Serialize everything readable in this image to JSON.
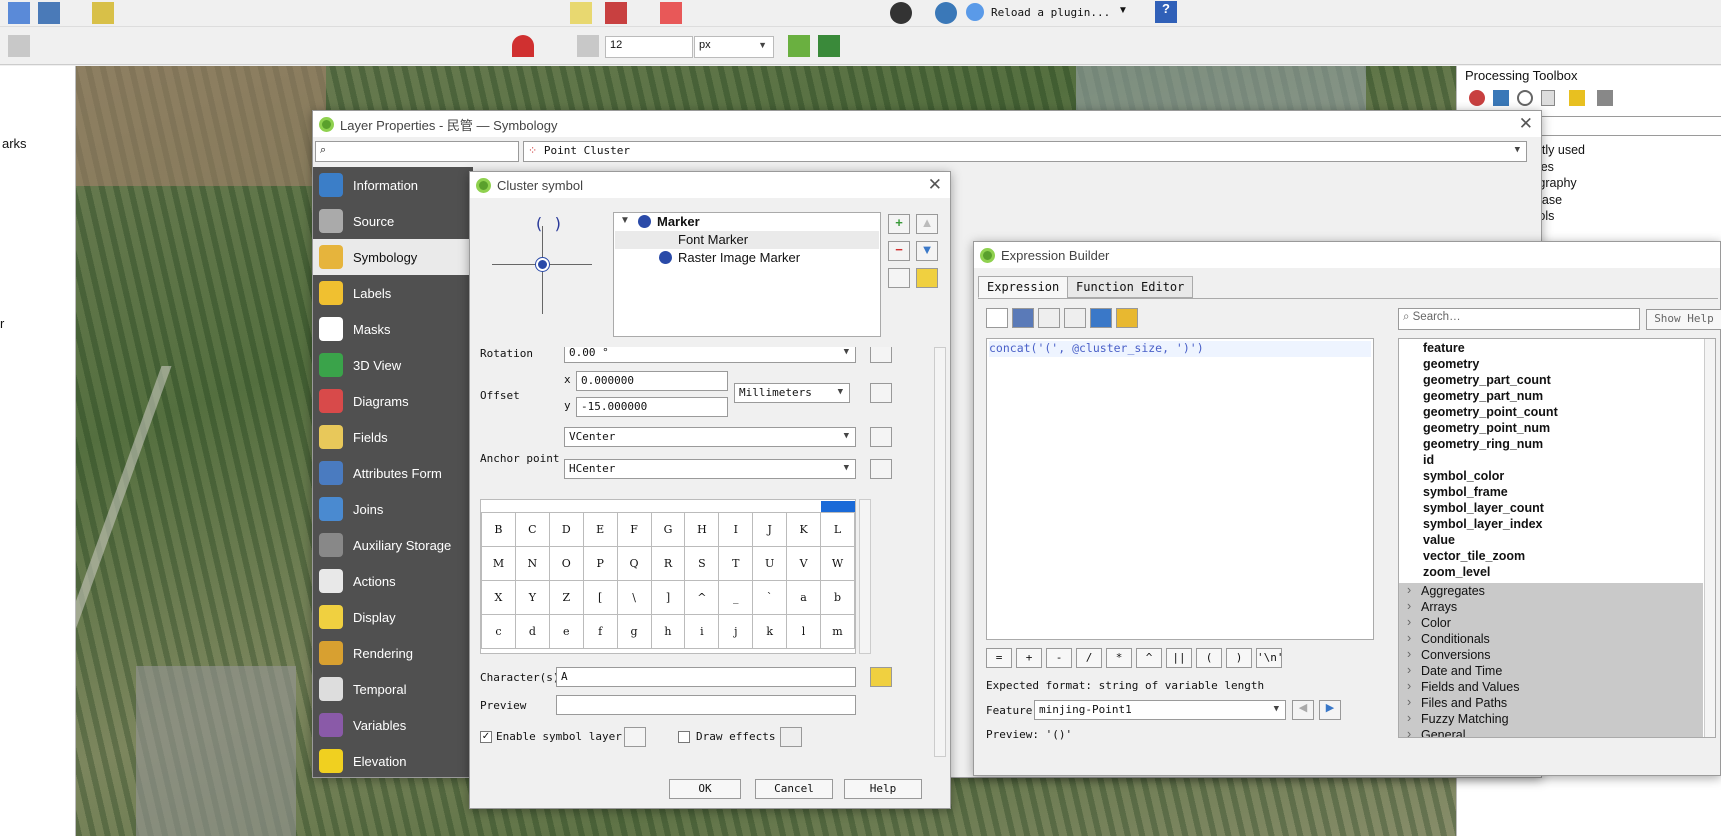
{
  "toolbar": {
    "reload_label": "Reload a plugin...",
    "size_value": "12",
    "size_unit": "px"
  },
  "processing": {
    "title": "Processing Toolbox",
    "items": [
      "ently used",
      "Tiles",
      "tography",
      "abase",
      "tools"
    ],
    "search_placeholder": "..."
  },
  "leftdock": {
    "items": [
      "arks",
      "r"
    ]
  },
  "layer_props": {
    "title": "Layer Properties - 民管 — Symbology",
    "renderer": "Point Cluster",
    "nav": [
      {
        "label": "Information",
        "icon": "info-icon",
        "color": "#3b7ec8"
      },
      {
        "label": "Source",
        "icon": "source-icon",
        "color": "#aaaaaa"
      },
      {
        "label": "Symbology",
        "icon": "brush-icon",
        "color": "#e6b43c"
      },
      {
        "label": "Labels",
        "icon": "labels-icon",
        "color": "#f0c030"
      },
      {
        "label": "Masks",
        "icon": "masks-icon",
        "color": "#ffffff"
      },
      {
        "label": "3D View",
        "icon": "cube-icon",
        "color": "#3aa34a"
      },
      {
        "label": "Diagrams",
        "icon": "diagrams-icon",
        "color": "#d84a4a"
      },
      {
        "label": "Fields",
        "icon": "fields-icon",
        "color": "#e8c85a"
      },
      {
        "label": "Attributes Form",
        "icon": "form-icon",
        "color": "#4a7bc0"
      },
      {
        "label": "Joins",
        "icon": "joins-icon",
        "color": "#4a8ad0"
      },
      {
        "label": "Auxiliary Storage",
        "icon": "storage-icon",
        "color": "#888888"
      },
      {
        "label": "Actions",
        "icon": "actions-icon",
        "color": "#e8e8e8"
      },
      {
        "label": "Display",
        "icon": "display-icon",
        "color": "#f0d040"
      },
      {
        "label": "Rendering",
        "icon": "rendering-icon",
        "color": "#d8a030"
      },
      {
        "label": "Temporal",
        "icon": "clock-icon",
        "color": "#dddddd"
      },
      {
        "label": "Variables",
        "icon": "variables-icon",
        "color": "#8a5aa8"
      },
      {
        "label": "Elevation",
        "icon": "elevation-icon",
        "color": "#f0d020"
      }
    ]
  },
  "cluster": {
    "title": "Cluster symbol",
    "tree": {
      "root": "Marker",
      "children": [
        "Font Marker",
        "Raster Image Marker"
      ]
    },
    "rotation_label": "Rotation",
    "rotation_value": "0.00 °",
    "offset_label": "Offset",
    "offset_x_label": "x",
    "offset_x": "0.000000",
    "offset_y_label": "y",
    "offset_y": "-15.000000",
    "offset_unit": "Millimeters",
    "anchor_label": "Anchor point",
    "anchor_v": "VCenter",
    "anchor_h": "HCenter",
    "char_rows": [
      [
        "B",
        "C",
        "D",
        "E",
        "F",
        "G",
        "H",
        "I",
        "J",
        "K",
        "L"
      ],
      [
        "M",
        "N",
        "O",
        "P",
        "Q",
        "R",
        "S",
        "T",
        "U",
        "V",
        "W"
      ],
      [
        "X",
        "Y",
        "Z",
        "[",
        "\\",
        "]",
        "^",
        "_",
        "`",
        "a",
        "b"
      ],
      [
        "c",
        "d",
        "e",
        "f",
        "g",
        "h",
        "i",
        "j",
        "k",
        "l",
        "m"
      ]
    ],
    "characters_label": "Character(s)",
    "characters_value": "A",
    "preview_label": "Preview",
    "enable_label": "Enable symbol layer",
    "draw_effects_label": "Draw effects",
    "ok": "OK",
    "cancel": "Cancel",
    "help": "Help"
  },
  "expr": {
    "title": "Expression Builder",
    "tab_expression": "Expression",
    "tab_function": "Function Editor",
    "expression": "concat('(', @cluster_size, ')')",
    "search_placeholder": "Search…",
    "show_help": "Show Help",
    "fields": [
      "feature",
      "geometry",
      "geometry_part_count",
      "geometry_part_num",
      "geometry_point_count",
      "geometry_point_num",
      "geometry_ring_num",
      "id",
      "symbol_color",
      "symbol_frame",
      "symbol_layer_count",
      "symbol_layer_index",
      "value",
      "vector_tile_zoom",
      "zoom_level"
    ],
    "groups": [
      "Aggregates",
      "Arrays",
      "Color",
      "Conditionals",
      "Conversions",
      "Date and Time",
      "Fields and Values",
      "Files and Paths",
      "Fuzzy Matching",
      "General"
    ],
    "operators": [
      "=",
      "+",
      "-",
      "/",
      "*",
      "^",
      "||",
      "(",
      ")",
      "'\\n'"
    ],
    "expected_format": "Expected format: string of variable length",
    "feature_label": "Feature",
    "feature_value": "minjing-Point1",
    "preview": "Preview:  '()'"
  }
}
